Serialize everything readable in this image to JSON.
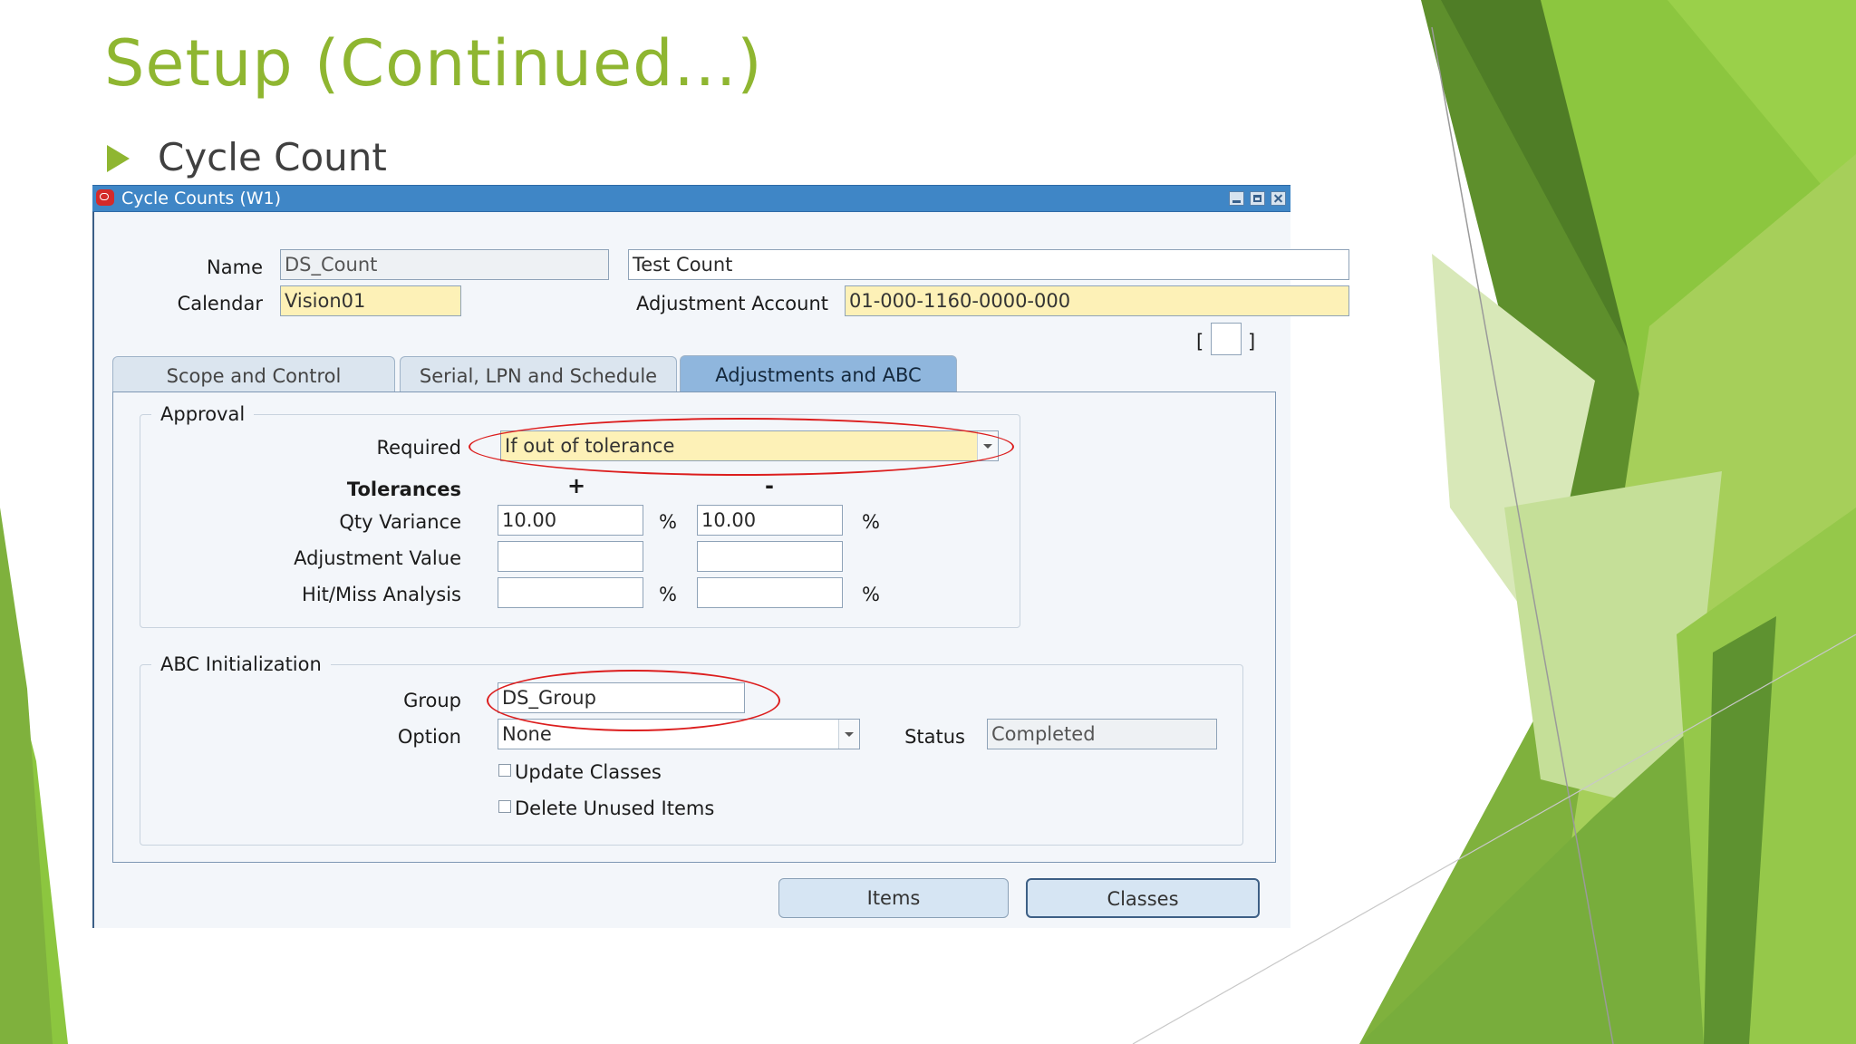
{
  "slide": {
    "title": "Setup (Continued...)",
    "bullet_text": "Cycle Count"
  },
  "colors": {
    "title_green": "#8fb631",
    "titlebar_blue": "#3f86c6",
    "required_field_yellow": "#fdf1b7",
    "highlight_red": "#dc1e1e"
  },
  "window": {
    "title": "Cycle Counts (W1)",
    "icon": "oracle-app-icon"
  },
  "header": {
    "name_label": "Name",
    "name_value": "DS_Count",
    "description_value": "Test Count",
    "calendar_label": "Calendar",
    "calendar_value": "Vision01",
    "adjustment_account_label": "Adjustment Account",
    "adjustment_account_value": "01-000-1160-0000-000",
    "bracket_open": "[",
    "bracket_close": "]"
  },
  "tabs": [
    {
      "label": "Scope and Control",
      "active": false
    },
    {
      "label": "Serial, LPN and Schedule",
      "active": false
    },
    {
      "label": "Adjustments and ABC",
      "active": true
    }
  ],
  "approval": {
    "group_label": "Approval",
    "required_label": "Required",
    "required_value": "If out of tolerance",
    "tolerances_label": "Tolerances",
    "plus_header": "+",
    "minus_header": "-",
    "qty_variance_label": "Qty Variance",
    "qty_variance_plus": "10.00",
    "qty_variance_minus": "10.00",
    "percent": "%",
    "adjustment_value_label": "Adjustment Value",
    "adjustment_value_plus": "",
    "adjustment_value_minus": "",
    "hit_miss_label": "Hit/Miss Analysis",
    "hit_miss_plus": "",
    "hit_miss_minus": ""
  },
  "abc": {
    "group_label": "ABC Initialization",
    "group_field_label": "Group",
    "group_value": "DS_Group",
    "option_label": "Option",
    "option_value": "None",
    "status_label": "Status",
    "status_value": "Completed",
    "update_classes_label": "Update Classes",
    "update_classes_checked": false,
    "delete_unused_label": "Delete Unused Items",
    "delete_unused_checked": false
  },
  "buttons": {
    "items_label": "Items",
    "classes_label": "Classes"
  }
}
